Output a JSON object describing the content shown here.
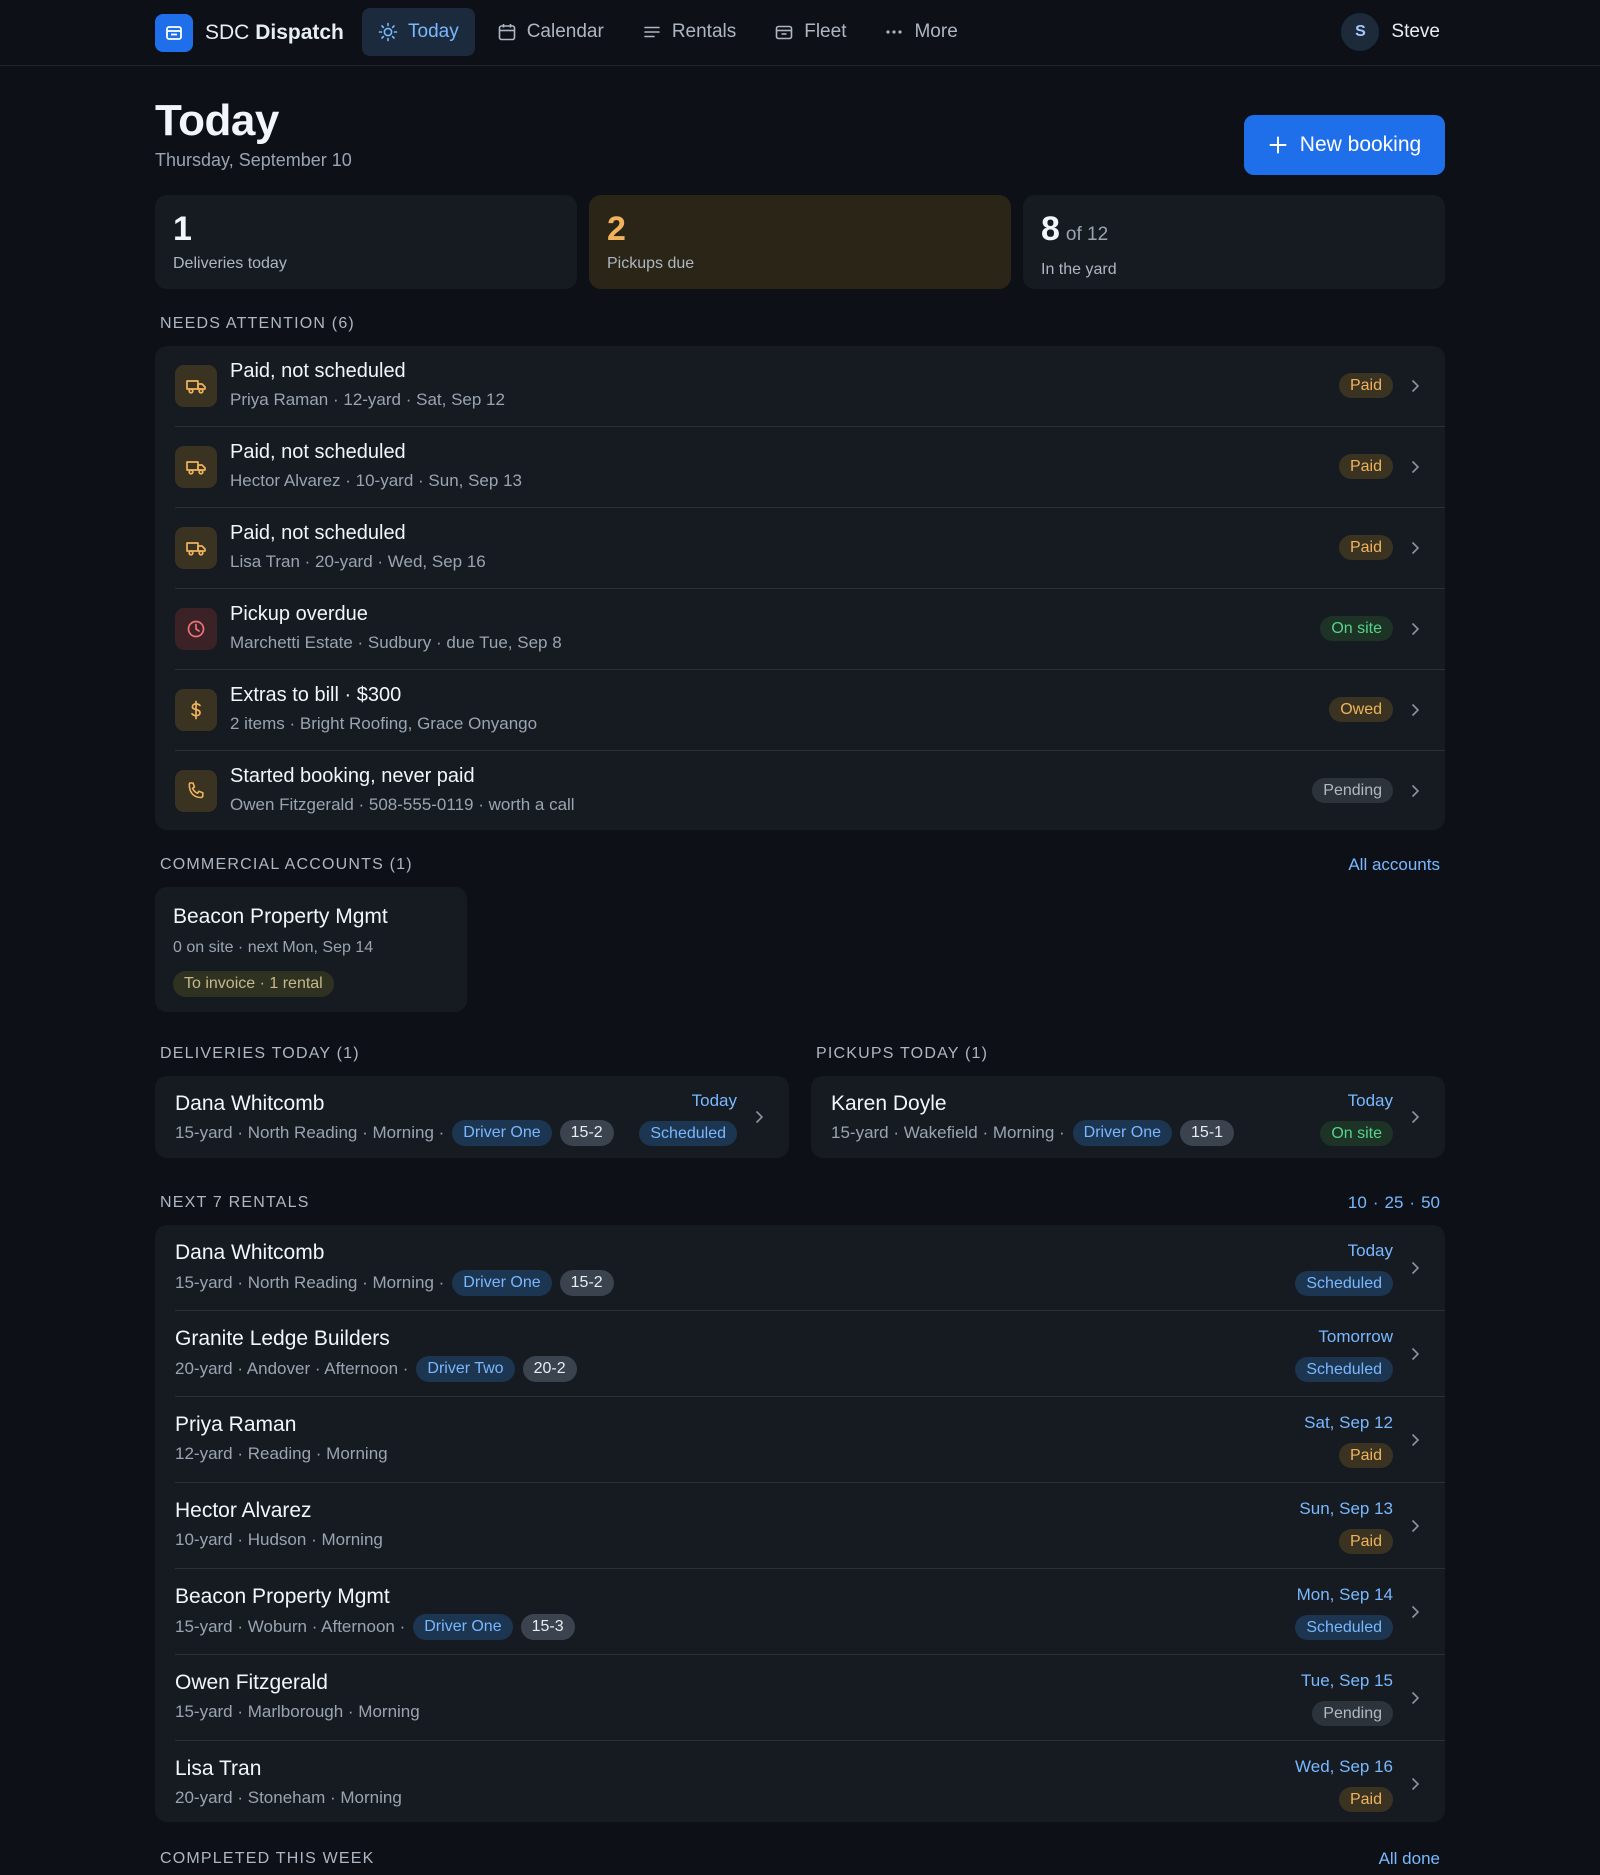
{
  "topbar": {
    "brand_light": "SDC",
    "brand_bold": "Dispatch",
    "nav": [
      {
        "label": "Today",
        "icon": "sun-icon",
        "active": true
      },
      {
        "label": "Calendar",
        "icon": "calendar-icon",
        "active": false
      },
      {
        "label": "Rentals",
        "icon": "list-icon",
        "active": false
      },
      {
        "label": "Fleet",
        "icon": "container-icon",
        "active": false
      },
      {
        "label": "More",
        "icon": "dots-icon",
        "active": false
      }
    ],
    "user_initial": "S",
    "user_name": "Steve"
  },
  "header": {
    "title": "Today",
    "date": "Thursday, September 10",
    "new_booking": "New booking"
  },
  "stats": [
    {
      "value": "1",
      "suffix": "",
      "label": "Deliveries today"
    },
    {
      "value": "2",
      "suffix": "",
      "label": "Pickups due"
    },
    {
      "value": "8",
      "suffix": "of 12",
      "label": "In the yard"
    }
  ],
  "attention": {
    "label": "NEEDS ATTENTION (6)",
    "items": [
      {
        "icon": "truck-icon",
        "title": "Paid, not scheduled",
        "sub": "Priya Raman · 12-yard · Sat, Sep 12",
        "badge": "Paid"
      },
      {
        "icon": "truck-icon",
        "title": "Paid, not scheduled",
        "sub": "Hector Alvarez · 10-yard · Sun, Sep 13",
        "badge": "Paid"
      },
      {
        "icon": "truck-icon",
        "title": "Paid, not scheduled",
        "sub": "Lisa Tran · 20-yard · Wed, Sep 16",
        "badge": "Paid"
      },
      {
        "icon": "clock-icon",
        "title": "Pickup overdue",
        "sub": "Marchetti Estate · Sudbury · due Tue, Sep 8",
        "badge": "On site"
      },
      {
        "icon": "dollar-icon",
        "title": "Extras to bill · $300",
        "sub": "2 items · Bright Roofing, Grace Onyango",
        "badge": "Owed"
      },
      {
        "icon": "phone-icon",
        "title": "Started booking, never paid",
        "sub": "Owen Fitzgerald · 508-555-0119 · worth a call",
        "badge": "Pending"
      }
    ]
  },
  "commercial": {
    "label": "COMMERCIAL ACCOUNTS (1)",
    "link": "All accounts",
    "account": {
      "name": "Beacon Property Mgmt",
      "sub": "0 on site · next Mon, Sep 14",
      "badge": "To invoice · 1 rental"
    }
  },
  "deliveries": {
    "label": "DELIVERIES TODAY (1)",
    "item": {
      "name": "Dana Whitcomb",
      "sub": "15-yard · North Reading · Morning ·",
      "driver": "Driver One",
      "unit": "15-2",
      "date": "Today",
      "status": "Scheduled"
    }
  },
  "pickups": {
    "label": "PICKUPS TODAY (1)",
    "item": {
      "name": "Karen Doyle",
      "sub": "15-yard · Wakefield · Morning ·",
      "driver": "Driver One",
      "unit": "15-1",
      "date": "Today",
      "status": "On site"
    }
  },
  "next_rentals": {
    "label": "NEXT 7 RENTALS",
    "page_sizes": [
      "10",
      "25",
      "50"
    ],
    "items": [
      {
        "name": "Dana Whitcomb",
        "sub": "15-yard · North Reading · Morning ·",
        "driver": "Driver One",
        "unit": "15-2",
        "date": "Today",
        "status": "Scheduled"
      },
      {
        "name": "Granite Ledge Builders",
        "sub": "20-yard · Andover · Afternoon ·",
        "driver": "Driver Two",
        "unit": "20-2",
        "date": "Tomorrow",
        "status": "Scheduled"
      },
      {
        "name": "Priya Raman",
        "sub": "12-yard · Reading · Morning",
        "driver": "",
        "unit": "",
        "date": "Sat, Sep 12",
        "status": "Paid"
      },
      {
        "name": "Hector Alvarez",
        "sub": "10-yard · Hudson · Morning",
        "driver": "",
        "unit": "",
        "date": "Sun, Sep 13",
        "status": "Paid"
      },
      {
        "name": "Beacon Property Mgmt",
        "sub": "15-yard · Woburn · Afternoon ·",
        "driver": "Driver One",
        "unit": "15-3",
        "date": "Mon, Sep 14",
        "status": "Scheduled"
      },
      {
        "name": "Owen Fitzgerald",
        "sub": "15-yard · Marlborough · Morning",
        "driver": "",
        "unit": "",
        "date": "Tue, Sep 15",
        "status": "Pending"
      },
      {
        "name": "Lisa Tran",
        "sub": "20-yard · Stoneham · Morning",
        "driver": "",
        "unit": "",
        "date": "Wed, Sep 16",
        "status": "Paid"
      }
    ]
  },
  "completed": {
    "label": "COMPLETED THIS WEEK",
    "link": "All done"
  },
  "colors": {
    "background": "#0d1117",
    "card": "#161b22",
    "accent": "#1f6feb",
    "link": "#79b8ff",
    "amber": "#f0b35c",
    "green": "#56d38a"
  }
}
